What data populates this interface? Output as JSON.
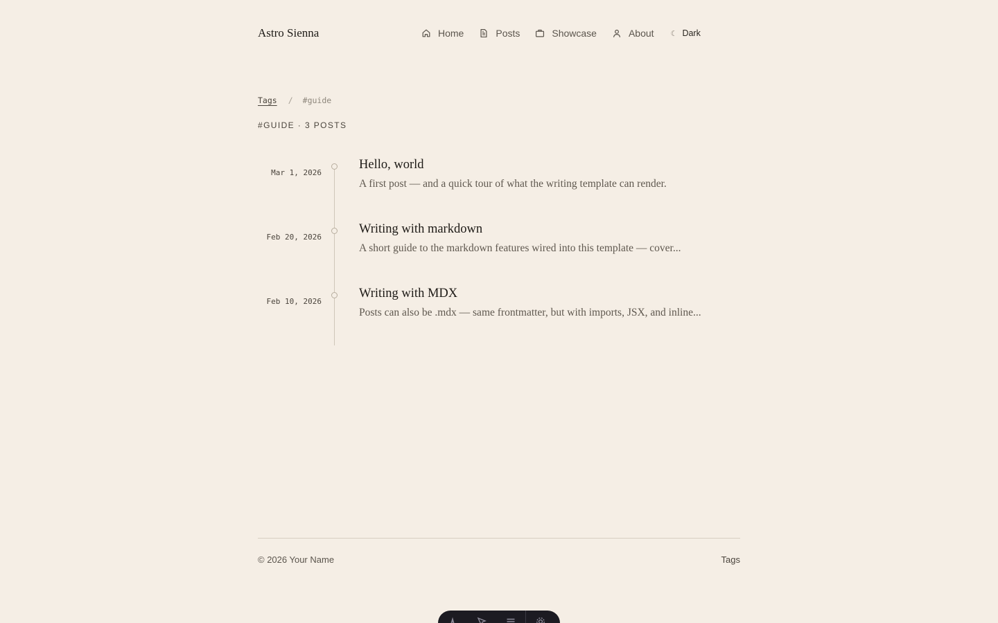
{
  "header": {
    "site_title": "Astro Sienna",
    "nav": [
      {
        "label": "Home",
        "icon": "home-icon"
      },
      {
        "label": "Posts",
        "icon": "document-icon"
      },
      {
        "label": "Showcase",
        "icon": "briefcase-icon"
      },
      {
        "label": "About",
        "icon": "user-icon"
      }
    ],
    "theme_toggle": {
      "icon": "moon-icon",
      "symbol": "☾",
      "label": "Dark"
    }
  },
  "breadcrumb": {
    "root": "Tags",
    "separator": "/",
    "current": "#guide"
  },
  "tag_heading": "#GUIDE · 3 POSTS",
  "posts": [
    {
      "date": "Mar 1, 2026",
      "title": "Hello, world",
      "excerpt": "A first post — and a quick tour of what the writing template can render."
    },
    {
      "date": "Feb 20, 2026",
      "title": "Writing with markdown",
      "excerpt": "A short guide to the markdown features wired into this template — cover..."
    },
    {
      "date": "Feb 10, 2026",
      "title": "Writing with MDX",
      "excerpt": "Posts can also be .mdx — same frontmatter, but with imports, JSX, and inline..."
    }
  ],
  "footer": {
    "copyright": "© 2026 Your Name",
    "tags_link": "Tags"
  },
  "dev_toolbar": {
    "icons": [
      "astro-icon",
      "pointer-icon",
      "menu-icon",
      "settings-icon"
    ]
  },
  "colors": {
    "background": "#f5eee5",
    "text": "#2a2620",
    "muted": "#5f584f",
    "rule": "#d8cfc2",
    "toolbar": "#1c1b22"
  }
}
